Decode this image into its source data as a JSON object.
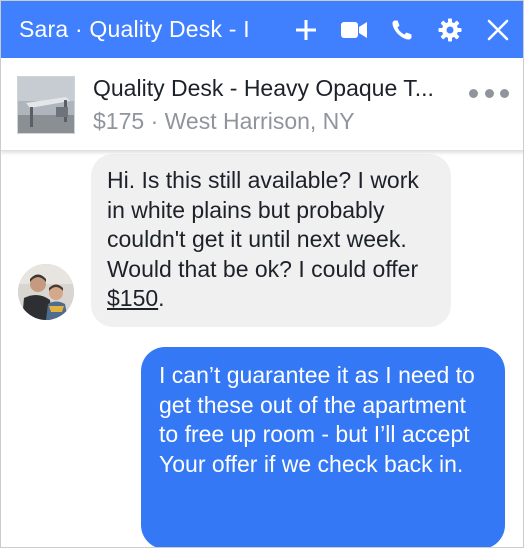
{
  "window": {
    "title": "Sara · Quality Desk - I",
    "icons": [
      "plus-icon",
      "video-camera-icon",
      "phone-icon",
      "gear-icon",
      "close-icon"
    ],
    "header_color": "#4080ff"
  },
  "listing": {
    "title": "Quality Desk - Heavy Opaque T...",
    "price": "$175",
    "separator": "·",
    "location": "West Harrison, NY",
    "more_icon": "more-dots-icon"
  },
  "messages": [
    {
      "sender": "other",
      "text_before_link": "Hi. Is this still available? I work in white plains but probably couldn't get it until next week. Would that be ok? I could offer ",
      "link_text": "$150",
      "text_after_link": ".",
      "bubble_color": "#f1f0f0"
    },
    {
      "sender": "me",
      "text": "I can’t guarantee it as I need to get these out of the apartment to free up room - but I’ll accept\nYour offer if we check back in.",
      "bubble_color": "#3578f6"
    }
  ]
}
